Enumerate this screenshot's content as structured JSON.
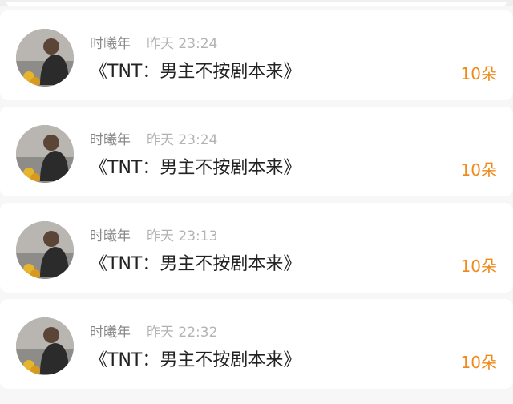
{
  "colors": {
    "background": "#f7f7f7",
    "card": "#ffffff",
    "username": "#8a8a8a",
    "time": "#b3b3b3",
    "title": "#222222",
    "accent": "#f08a1c"
  },
  "items": [
    {
      "avatar_icon": "user-avatar-photo",
      "username": "时曦年",
      "time": "昨天 23:24",
      "title": "《TNT：男主不按剧本来》",
      "flowers": "10朵"
    },
    {
      "avatar_icon": "user-avatar-photo",
      "username": "时曦年",
      "time": "昨天 23:24",
      "title": "《TNT：男主不按剧本来》",
      "flowers": "10朵"
    },
    {
      "avatar_icon": "user-avatar-photo",
      "username": "时曦年",
      "time": "昨天 23:13",
      "title": "《TNT：男主不按剧本来》",
      "flowers": "10朵"
    },
    {
      "avatar_icon": "user-avatar-photo",
      "username": "时曦年",
      "time": "昨天 22:32",
      "title": "《TNT：男主不按剧本来》",
      "flowers": "10朵"
    }
  ]
}
